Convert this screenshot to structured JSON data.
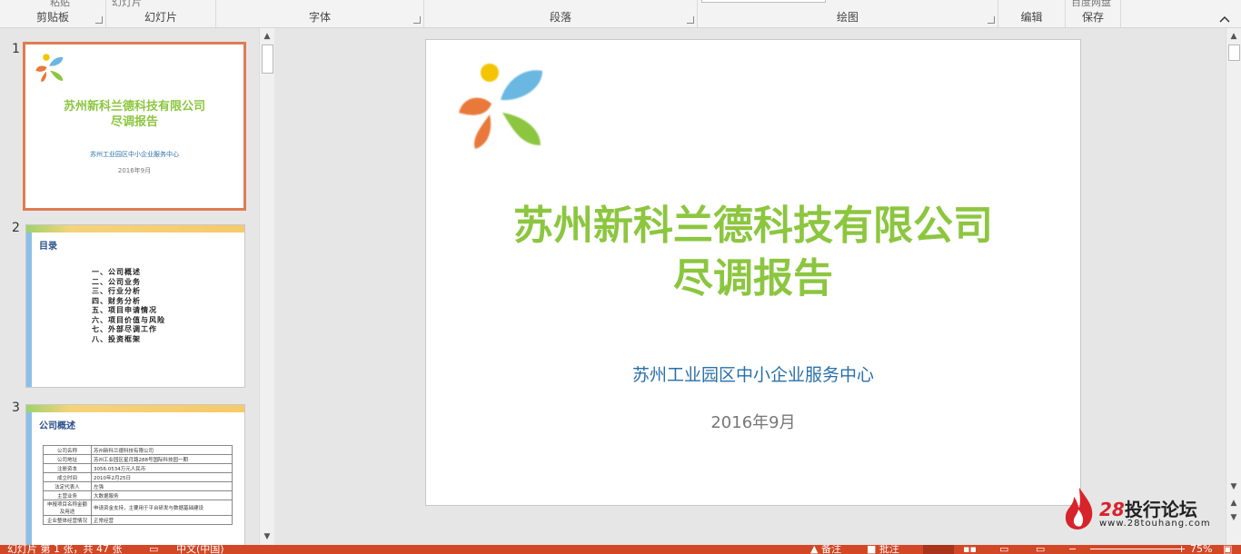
{
  "ribbon": {
    "groups": [
      {
        "label": "剪贴板",
        "top_fragment": "粘贴"
      },
      {
        "label": "幻灯片",
        "top_fragment": "幻灯片"
      },
      {
        "label": "字体"
      },
      {
        "label": "段落"
      },
      {
        "label": "绘图"
      },
      {
        "label": "编辑"
      },
      {
        "label": "保存",
        "top_fragment": "百度网盘"
      }
    ]
  },
  "thumbnails": [
    {
      "number": "1",
      "title_line1": "苏州新科兰德科技有限公司",
      "title_line2": "尽调报告",
      "subtitle": "苏州工业园区中小企业服务中心",
      "date": "2016年9月"
    },
    {
      "number": "2",
      "heading": "目录",
      "items": [
        "一、公司概述",
        "二、公司业务",
        "三、行业分析",
        "四、财务分析",
        "五、项目申请情况",
        "六、项目价值与风险",
        "七、外部尽调工作",
        "八、投资框架"
      ]
    },
    {
      "number": "3",
      "heading": "公司概述",
      "table": [
        [
          "公司名称",
          "苏州新科兰德科技有限公司"
        ],
        [
          "公司地址",
          "苏州工业园区星月路288号国际科技园一期"
        ],
        [
          "注册资本",
          "3056.0534万元人民币"
        ],
        [
          "成立时间",
          "2010年2月25日"
        ],
        [
          "法定代表人",
          "左强"
        ],
        [
          "主营业务",
          "大数据服务"
        ],
        [
          "申报项目名称金额及用途",
          "申请资金支持，主要用于平台研发与数据基础建设"
        ],
        [
          "企业整体经营情况",
          "正常经营"
        ]
      ]
    }
  ],
  "slide": {
    "title_line1": "苏州新科兰德科技有限公司",
    "title_line2": "尽调报告",
    "subtitle": "苏州工业园区中小企业服务中心",
    "date": "2016年9月"
  },
  "status_bar": {
    "slide_info": "幻灯片 第 1 张，共 47 张",
    "language": "中文(中国)",
    "notes": "备注",
    "comments": "批注",
    "zoom": "75%"
  },
  "watermark": {
    "number": "28",
    "name": "投行论坛",
    "url": "www.28touhang.com"
  },
  "colors": {
    "accent": "#d24726",
    "title_green": "#8cc63f",
    "subtitle_blue": "#2a6fa8",
    "selection": "#e07b53"
  }
}
